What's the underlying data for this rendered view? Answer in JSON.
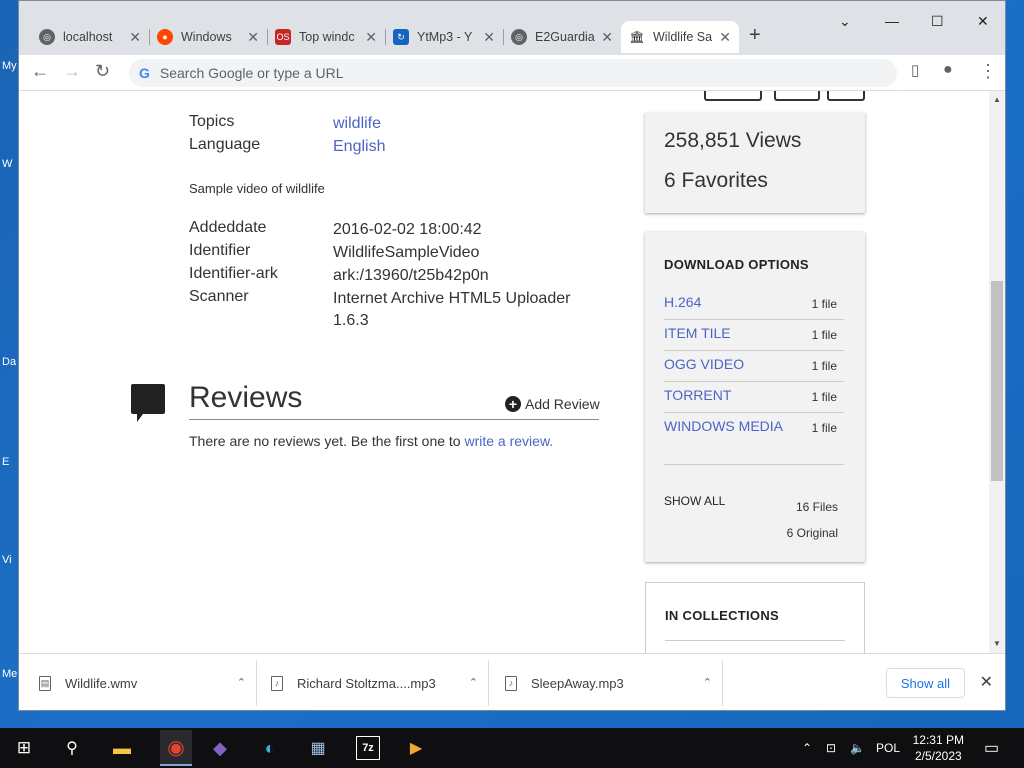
{
  "desktop": {
    "labels": [
      "My",
      "W",
      "Da",
      "E",
      "Vi",
      "Me"
    ]
  },
  "browser": {
    "tabs": [
      {
        "title": "localhost",
        "icon": "globe-icon"
      },
      {
        "title": "Windows",
        "icon": "reddit-icon"
      },
      {
        "title": "Top windc",
        "icon": "os-icon",
        "badge": "OS"
      },
      {
        "title": "YtMp3 - Y",
        "icon": "ytmp3-icon"
      },
      {
        "title": "E2Guardia",
        "icon": "globe-icon"
      },
      {
        "title": "Wildlife Sa",
        "icon": "archive-icon"
      }
    ],
    "new_tab": "+",
    "omnibox_placeholder": "Search Google or type a URL",
    "google_g": "G"
  },
  "metadata": {
    "topics_label": "Topics",
    "topics_value": "wildlife",
    "language_label": "Language",
    "language_value": "English",
    "description": "Sample video of wildlife",
    "addeddate_label": "Addeddate",
    "addeddate_value": "2016-02-02 18:00:42",
    "identifier_label": "Identifier",
    "identifier_value": "WildlifeSampleVideo",
    "identifier_ark_label": "Identifier-ark",
    "identifier_ark_value": "ark:/13960/t25b42p0n",
    "scanner_label": "Scanner",
    "scanner_value": "Internet Archive HTML5 Uploader 1.6.3"
  },
  "reviews": {
    "title": "Reviews",
    "add_review": "Add Review",
    "empty_text": "There are no reviews yet. Be the first one to",
    "write_link": "write a review."
  },
  "stats": {
    "views": "258,851 Views",
    "favorites": "6 Favorites"
  },
  "download_options": {
    "heading": "DOWNLOAD OPTIONS",
    "items": [
      {
        "name": "H.264",
        "count": "1 file"
      },
      {
        "name": "ITEM TILE",
        "count": "1 file"
      },
      {
        "name": "OGG VIDEO",
        "count": "1 file"
      },
      {
        "name": "TORRENT",
        "count": "1 file"
      },
      {
        "name": "WINDOWS MEDIA",
        "count": "1 file"
      }
    ],
    "show_all": "SHOW ALL",
    "files_total": "16 Files",
    "original_total": "6 Original"
  },
  "collections": {
    "heading": "IN COLLECTIONS"
  },
  "downloads_shelf": {
    "items": [
      {
        "name": "Wildlife.wmv"
      },
      {
        "name": "Richard Stoltzma....mp3"
      },
      {
        "name": "SleepAway.mp3"
      }
    ],
    "show_all": "Show all"
  },
  "taskbar": {
    "language": "POL",
    "time": "12:31 PM",
    "date": "2/5/2023"
  },
  "colors": {
    "link": "#4b64c6",
    "tab_strip": "#dee1e6",
    "taskbar": "#0f0f12"
  }
}
